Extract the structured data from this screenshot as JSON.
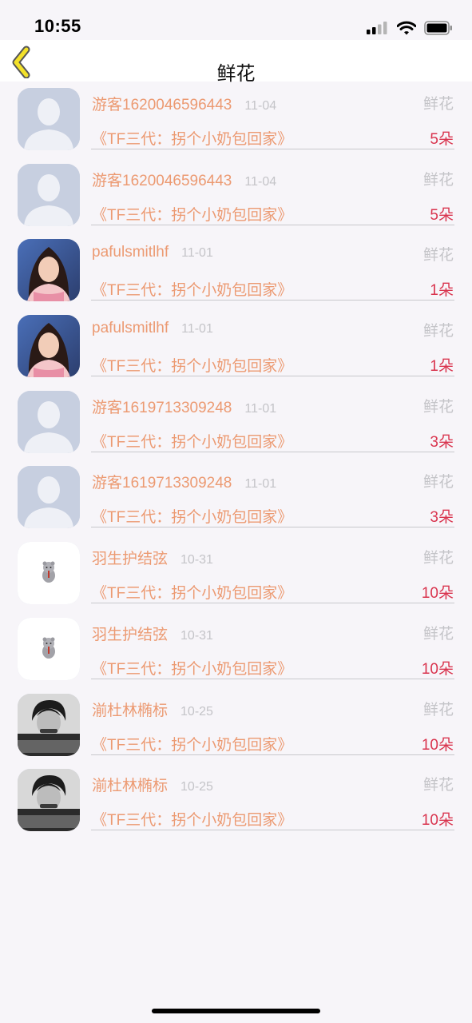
{
  "status_bar": {
    "time": "10:55"
  },
  "nav": {
    "title": "鲜花"
  },
  "items": [
    {
      "avatar": "default-avatar",
      "name": "游客1620046596443",
      "date": "11-04",
      "gift": "鲜花",
      "book": "《TF三代：拐个小奶包回家》",
      "count": "5朵"
    },
    {
      "avatar": "default-avatar",
      "name": "游客1620046596443",
      "date": "11-04",
      "gift": "鲜花",
      "book": "《TF三代：拐个小奶包回家》",
      "count": "5朵"
    },
    {
      "avatar": "girl-photo",
      "name": "pafulsmitlhf",
      "date": "11-01",
      "gift": "鲜花",
      "book": "《TF三代：拐个小奶包回家》",
      "count": "1朵"
    },
    {
      "avatar": "girl-photo",
      "name": "pafulsmitlhf",
      "date": "11-01",
      "gift": "鲜花",
      "book": "《TF三代：拐个小奶包回家》",
      "count": "1朵"
    },
    {
      "avatar": "default-avatar",
      "name": "游客1619713309248",
      "date": "11-01",
      "gift": "鲜花",
      "book": "《TF三代：拐个小奶包回家》",
      "count": "3朵"
    },
    {
      "avatar": "default-avatar",
      "name": "游客1619713309248",
      "date": "11-01",
      "gift": "鲜花",
      "book": "《TF三代：拐个小奶包回家》",
      "count": "3朵"
    },
    {
      "avatar": "cartoon-sticker",
      "name": "羽生护结弦",
      "date": "10-31",
      "gift": "鲜花",
      "book": "《TF三代：拐个小奶包回家》",
      "count": "10朵"
    },
    {
      "avatar": "cartoon-sticker",
      "name": "羽生护结弦",
      "date": "10-31",
      "gift": "鲜花",
      "book": "《TF三代：拐个小奶包回家》",
      "count": "10朵"
    },
    {
      "avatar": "bw-boy-photo",
      "name": "湔杜林椭标",
      "date": "10-25",
      "gift": "鲜花",
      "book": "《TF三代：拐个小奶包回家》",
      "count": "10朵"
    },
    {
      "avatar": "bw-boy-photo",
      "name": "湔杜林椭标",
      "date": "10-25",
      "gift": "鲜花",
      "book": "《TF三代：拐个小奶包回家》",
      "count": "10朵"
    }
  ],
  "colors": {
    "accent": "#ec9a72",
    "count": "#d9344e",
    "muted": "#c4c4c8",
    "background": "#f7f5f9"
  }
}
